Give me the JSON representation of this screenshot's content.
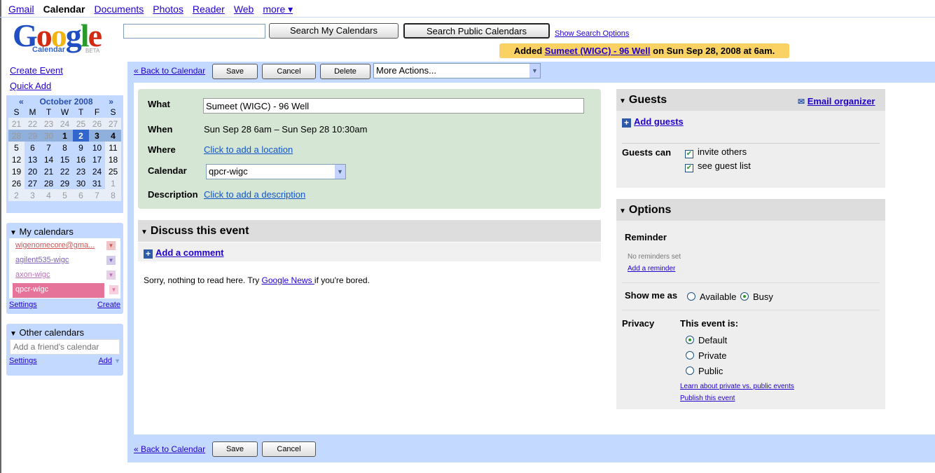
{
  "topnav": {
    "items": [
      "Gmail",
      "Calendar",
      "Documents",
      "Photos",
      "Reader",
      "Web",
      "more ▾"
    ]
  },
  "logo": {
    "text": "Google",
    "sub": "Calendar",
    "beta": "BETA"
  },
  "search": {
    "value": "",
    "my_label": "Search My Calendars",
    "public_label": "Search Public Calendars",
    "options_label": "Show Search Options"
  },
  "notice": {
    "prefix": "Added ",
    "event": "Sumeet (WIGC) - 96 Well",
    "suffix": " on Sun Sep 28, 2008 at 6am."
  },
  "sidebar": {
    "create_event": "Create Event",
    "quick_add": "Quick Add",
    "minical": {
      "prev": "«",
      "next": "»",
      "title": "October 2008",
      "days": [
        "S",
        "M",
        "T",
        "W",
        "T",
        "F",
        "S"
      ],
      "weeks": [
        [
          "21",
          "22",
          "23",
          "24",
          "25",
          "26",
          "27"
        ],
        [
          "28",
          "29",
          "30",
          "1",
          "2",
          "3",
          "4"
        ],
        [
          "5",
          "6",
          "7",
          "8",
          "9",
          "10",
          "11"
        ],
        [
          "12",
          "13",
          "14",
          "15",
          "16",
          "17",
          "18"
        ],
        [
          "19",
          "20",
          "21",
          "22",
          "23",
          "24",
          "25"
        ],
        [
          "26",
          "27",
          "28",
          "29",
          "30",
          "31",
          "1"
        ],
        [
          "2",
          "3",
          "4",
          "5",
          "6",
          "7",
          "8"
        ]
      ]
    },
    "my_calendars": {
      "title": "My calendars",
      "items": [
        {
          "label": "wigenomecore@gma...",
          "color": "#cc5555"
        },
        {
          "label": "agilent535-wigc",
          "color": "#7b5fb8"
        },
        {
          "label": "axon-wigc",
          "color": "#b373b3"
        },
        {
          "label": "qpcr-wigc",
          "color": "#e67399"
        }
      ],
      "settings": "Settings",
      "create": "Create"
    },
    "other_calendars": {
      "title": "Other calendars",
      "placeholder": "Add a friend's calendar",
      "settings": "Settings",
      "add": "Add"
    }
  },
  "toolbar": {
    "back": "« Back to Calendar",
    "save": "Save",
    "cancel": "Cancel",
    "delete": "Delete",
    "more_actions": "More Actions..."
  },
  "event": {
    "what_label": "What",
    "what": "Sumeet (WIGC) - 96 Well",
    "when_label": "When",
    "when": "Sun Sep 28 6am – Sun Sep 28 10:30am",
    "where_label": "Where",
    "where": "Click to add a location",
    "calendar_label": "Calendar",
    "calendar": "qpcr-wigc",
    "description_label": "Description",
    "description": "Click to add a description"
  },
  "discuss": {
    "title": "Discuss this event",
    "add_comment": "Add a comment",
    "empty_prefix": "Sorry, nothing to read here. Try ",
    "empty_link": "Google News ",
    "empty_suffix": "if you're bored."
  },
  "guests": {
    "title": "Guests",
    "email_organizer": "Email organizer",
    "add_guests": "Add guests",
    "guests_can": "Guests can",
    "invite_others": "invite others",
    "see_guest_list": "see guest list",
    "invite_checked": true,
    "see_checked": true
  },
  "options": {
    "title": "Options",
    "reminder": "Reminder",
    "no_reminders": "No reminders set",
    "add_reminder": "Add a reminder",
    "show_me_as": "Show me as",
    "available": "Available",
    "busy": "Busy",
    "show_selected": "Busy",
    "privacy": "Privacy",
    "this_event_is": "This event is:",
    "default": "Default",
    "private": "Private",
    "public": "Public",
    "privacy_selected": "Default",
    "learn": "Learn about private vs. public events",
    "publish": "Publish this event"
  }
}
